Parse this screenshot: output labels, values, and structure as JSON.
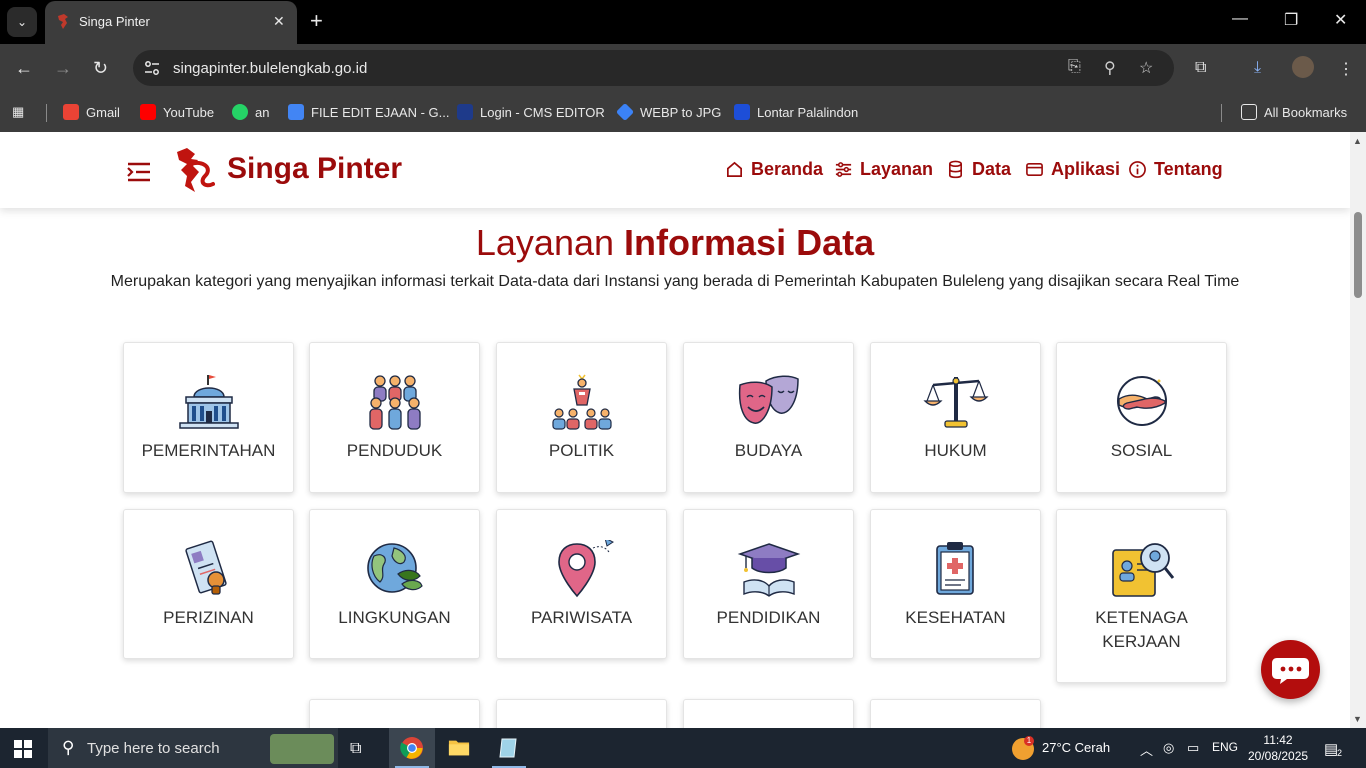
{
  "browser": {
    "tab_title": "Singa Pinter",
    "url": "singapinter.bulelengkab.go.id",
    "bookmarks": [
      {
        "label": "Gmail",
        "color": "#ea4335"
      },
      {
        "label": "YouTube",
        "color": "#ff0000"
      },
      {
        "label": "an",
        "color": "#25d366"
      },
      {
        "label": "FILE EDIT EJAAN - G...",
        "color": "#4285f4"
      },
      {
        "label": "Login - CMS EDITOR",
        "color": "#1e3a8a"
      },
      {
        "label": "WEBP to JPG",
        "color": "#3b82f6"
      },
      {
        "label": "Lontar Palalindon",
        "color": "#1d4ed8"
      }
    ],
    "all_bookmarks": "All Bookmarks"
  },
  "site": {
    "brand": "Singa Pinter",
    "nav": [
      "Beranda",
      "Layanan",
      "Data",
      "Aplikasi",
      "Tentang"
    ],
    "title_light": "Layanan",
    "title_bold": "Informasi Data",
    "subtitle": "Merupakan kategori yang menyajikan informasi terkait Data-data dari Instansi yang berada di Pemerintah Kabupaten Buleleng yang disajikan secara Real Time",
    "categories_row1": [
      "PEMERINTAHAN",
      "PENDUDUK",
      "POLITIK",
      "BUDAYA",
      "HUKUM",
      "SOSIAL"
    ],
    "categories_row2": [
      "PERIZINAN",
      "LINGKUNGAN",
      "PARIWISATA",
      "PENDIDIKAN",
      "KESEHATAN",
      "KETENAGA KERJAAN"
    ]
  },
  "taskbar": {
    "search_placeholder": "Type here to search",
    "weather": "27°C  Cerah",
    "weather_badge": "1",
    "lang": "ENG",
    "time": "11:42",
    "date": "20/08/2025",
    "notifications": "2"
  },
  "colors": {
    "brand": "#9b0b0b",
    "fab": "#b30d0d"
  }
}
